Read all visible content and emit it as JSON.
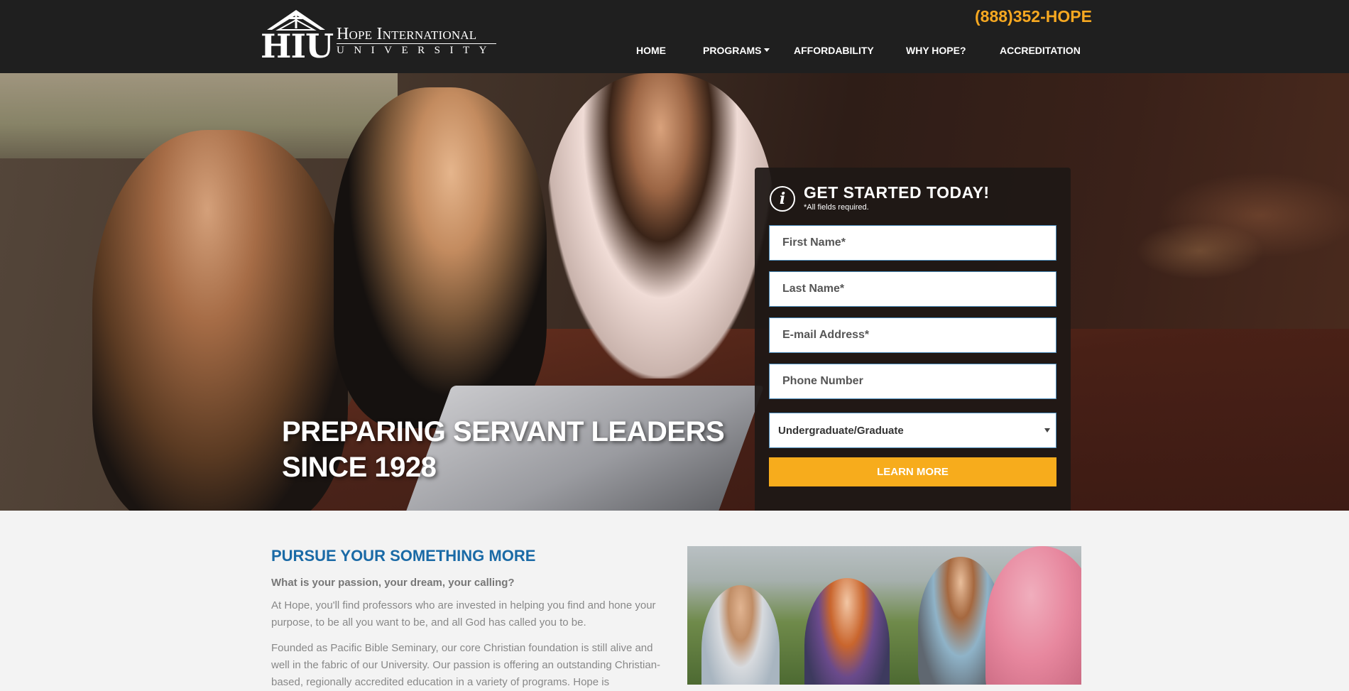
{
  "header": {
    "logo_mark": "HIU",
    "logo_line1": "Hope International",
    "logo_line2": "UNIVERSITY",
    "phone": "(888)352-HOPE",
    "nav": [
      {
        "label": "HOME"
      },
      {
        "label": "PROGRAMS",
        "has_dropdown": true
      },
      {
        "label": "AFFORDABILITY"
      },
      {
        "label": "WHY HOPE?"
      },
      {
        "label": "ACCREDITATION"
      }
    ]
  },
  "hero": {
    "title_line1": "PREPARING SERVANT LEADERS",
    "title_line2": "SINCE 1928"
  },
  "form": {
    "title": "GET STARTED TODAY!",
    "subtitle": "*All fields required.",
    "first_name_placeholder": "First Name*",
    "last_name_placeholder": "Last Name*",
    "email_placeholder": "E-mail Address*",
    "phone_placeholder": "Phone Number",
    "program_level_selected": "Undergraduate/Graduate",
    "submit_label": "LEARN MORE"
  },
  "content": {
    "heading": "PURSUE YOUR SOMETHING MORE",
    "lead": "What is your passion, your dream, your calling?",
    "para1": "At Hope, you'll find professors who are invested in helping you find and hone your purpose, to be all you want to be, and all God has called you to be.",
    "para2": "Founded as Pacific Bible Seminary, our core Christian foundation is still alive and well in the fabric of our University. Our passion is offering an outstanding Christian-based, regionally accredited education in a variety of programs. Hope is"
  },
  "colors": {
    "header_bg": "#1f1f1f",
    "accent_orange": "#f7ac1c",
    "phone_color": "#f6a821",
    "heading_blue": "#1a6aa6"
  }
}
